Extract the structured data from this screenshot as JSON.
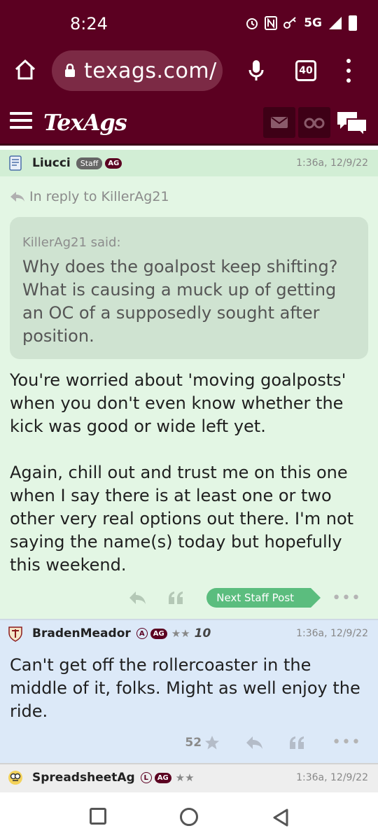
{
  "status": {
    "time": "8:24",
    "network": "5G"
  },
  "browser": {
    "url": "texags.com/",
    "tab_count": "40"
  },
  "site": {
    "logo_text": "TexAgs"
  },
  "posts": [
    {
      "username": "Liucci",
      "badges": [
        "Staff",
        "AG"
      ],
      "timestamp": "1:36a, 12/9/22",
      "reply_to": "In reply to KillerAg21",
      "quote": {
        "author": "KillerAg21 said:",
        "text": "Why does the goalpost keep shifting? What is causing a muck up of getting an OC of a supposedly sought after position."
      },
      "body": "You're worried about 'moving goalposts' when you don't even know whether the kick was good or wide left yet.\n\nAgain, chill out and trust me on this one when I say there is at least one or two other very real options out there. I'm not saying the name(s) today but hopefully this weekend.",
      "next_staff_label": "Next Staff Post"
    },
    {
      "username": "BradenMeador",
      "badges": [
        "A",
        "AG"
      ],
      "stars": "★★",
      "years": "10",
      "timestamp": "1:36a, 12/9/22",
      "body": "Can't get off the rollercoaster in the middle of it, folks. Might as well enjoy the ride.",
      "star_count": "52"
    },
    {
      "username": "SpreadsheetAg",
      "badges": [
        "L",
        "AG"
      ],
      "stars": "★★",
      "timestamp": "1:36a, 12/9/22"
    }
  ],
  "colors": {
    "maroon": "#5b0021",
    "staff_post_bg": "#e3f6e4",
    "member_post_bg": "#dce9f8",
    "next_staff_green": "#5bbd7e"
  },
  "icons": [
    "home-icon",
    "lock-icon",
    "mic-icon",
    "tabs-icon",
    "menu-icon",
    "hamburger-icon",
    "mail-icon",
    "binoculars-icon",
    "chat-icon",
    "reply-icon",
    "quote-icon",
    "star-icon",
    "more-icon"
  ]
}
